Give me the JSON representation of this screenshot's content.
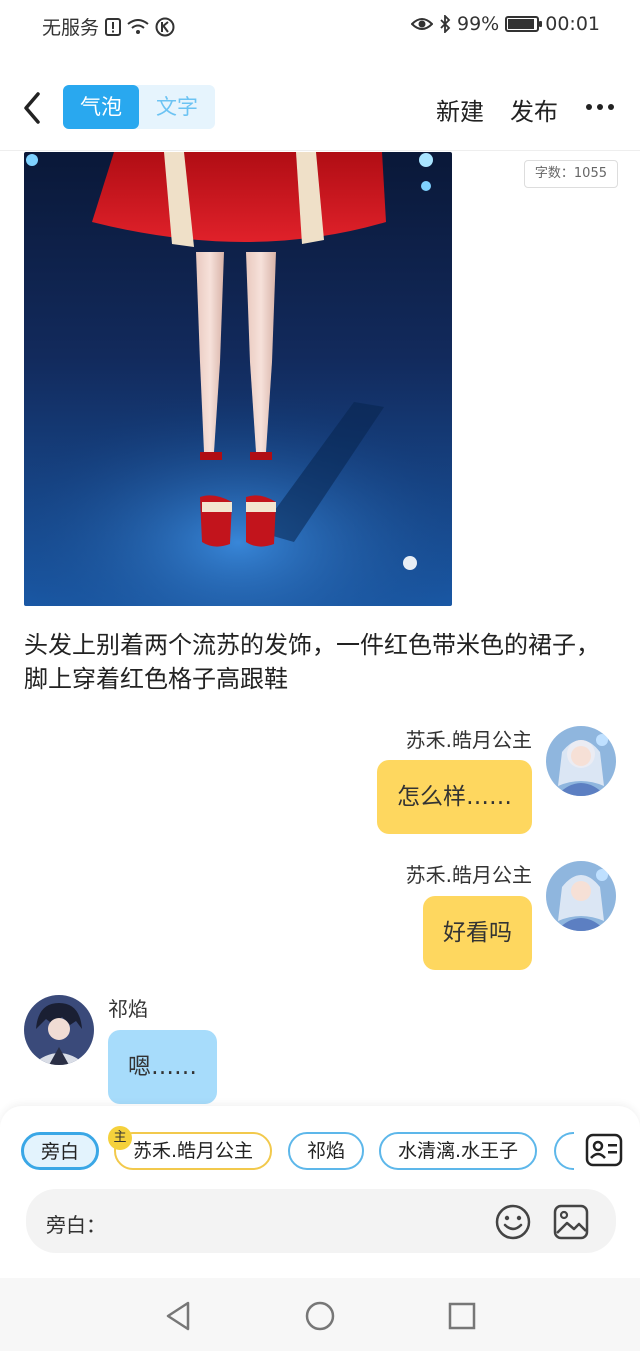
{
  "status_bar": {
    "carrier": "无服务",
    "battery": "99%",
    "time": "00:01"
  },
  "nav": {
    "tab_bubble": "气泡",
    "tab_text": "文字",
    "new_label": "新建",
    "publish_label": "发布"
  },
  "word_count": "字数：1055",
  "narration": "头发上别着两个流苏的发饰，一件红色带米色的裙子，脚上穿着红色格子高跟鞋",
  "messages": [
    {
      "sender": "苏禾.皓月公主",
      "text": "怎么样……",
      "side": "right"
    },
    {
      "sender": "苏禾.皓月公主",
      "text": "好看吗",
      "side": "right"
    },
    {
      "sender": "祁焰",
      "text": "嗯……",
      "side": "left"
    }
  ],
  "roles": {
    "narrator": "旁白",
    "main_badge": "主",
    "role1": "苏禾.皓月公主",
    "role2": "祁焰",
    "role3": "水清漓.水王子"
  },
  "input": {
    "prefix": "旁白："
  },
  "colors": {
    "accent_blue": "#29a8ef",
    "bubble_yellow": "#fed75f",
    "bubble_blue": "#a7dcfb"
  }
}
